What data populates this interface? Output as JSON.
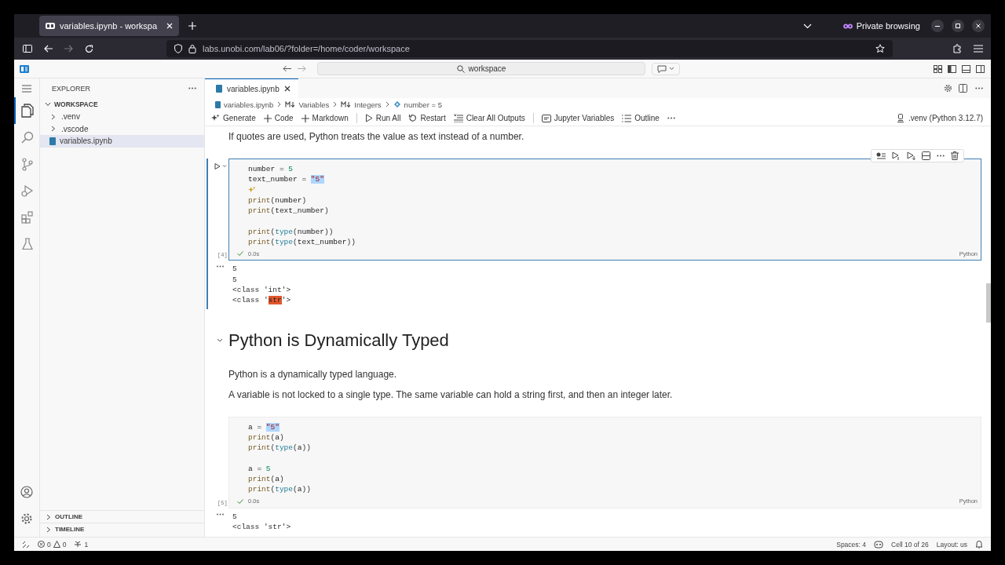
{
  "browser": {
    "tab_title": "variables.ipynb - workspa",
    "private_label": "Private browsing",
    "url": "labs.unobi.com/lab06/?folder=/home/coder/workspace"
  },
  "command_center": {
    "label": "workspace"
  },
  "activity_bar": [
    {
      "kind": "explorer",
      "selected": true
    },
    {
      "kind": "search",
      "selected": false
    },
    {
      "kind": "source-control",
      "selected": false
    },
    {
      "kind": "run",
      "selected": false
    },
    {
      "kind": "extensions",
      "selected": false
    },
    {
      "kind": "testing",
      "selected": false
    }
  ],
  "sidebar": {
    "title": "EXPLORER",
    "section": "WORKSPACE",
    "items": [
      {
        "label": ".venv",
        "kind": "folder",
        "selected": false
      },
      {
        "label": ".vscode",
        "kind": "folder",
        "selected": false
      },
      {
        "label": "variables.ipynb",
        "kind": "notebook",
        "selected": true
      }
    ],
    "panels": [
      {
        "label": "OUTLINE"
      },
      {
        "label": "TIMELINE"
      }
    ]
  },
  "editor": {
    "tabs": [
      {
        "label": "variables.ipynb",
        "selected": true
      }
    ],
    "breadcrumbs": [
      {
        "label": "variables.ipynb",
        "kind": "notebook"
      },
      {
        "label": "Variables",
        "kind": "markdown"
      },
      {
        "label": "Integers",
        "kind": "markdown"
      },
      {
        "label": "number = 5",
        "kind": "code"
      }
    ],
    "toolbar": [
      [
        {
          "label": "Generate",
          "kind": "generate"
        },
        {
          "label": "Code",
          "kind": "add"
        },
        {
          "label": "Markdown",
          "kind": "add"
        }
      ],
      [
        {
          "label": "Run All",
          "kind": "run"
        },
        {
          "label": "Restart",
          "kind": "restart"
        },
        {
          "label": "Clear All Outputs",
          "kind": "clear"
        }
      ],
      [
        {
          "label": "Jupyter Variables",
          "kind": "variables"
        },
        {
          "label": "Outline",
          "kind": "outline"
        }
      ]
    ],
    "kernel": ".venv (Python 3.12.7)"
  },
  "cells": [
    {
      "kind": "markdown",
      "paragraphs": [
        "If quotes are used, Python treats the value as text instead of a number."
      ]
    },
    {
      "kind": "code",
      "selected": true,
      "count": "[4]",
      "duration": "0.0s",
      "language": "Python",
      "lines": [
        {
          "kind": "code",
          "tokens": [
            {
              "text": "number",
              "kind": "id"
            },
            {
              "text": " = ",
              "kind": "op"
            },
            {
              "text": "5",
              "kind": "num"
            }
          ]
        },
        {
          "kind": "code",
          "tokens": [
            {
              "text": "text_number",
              "kind": "id"
            },
            {
              "text": " = ",
              "kind": "op"
            },
            {
              "text": "\"5\"",
              "kind": "str",
              "highlighted": true
            }
          ]
        },
        {
          "kind": "hint"
        },
        {
          "kind": "code",
          "tokens": [
            {
              "text": "print",
              "kind": "fn"
            },
            {
              "text": "(",
              "kind": "op"
            },
            {
              "text": "number",
              "kind": "id"
            },
            {
              "text": ")",
              "kind": "op"
            }
          ]
        },
        {
          "kind": "code",
          "tokens": [
            {
              "text": "print",
              "kind": "fn"
            },
            {
              "text": "(",
              "kind": "op"
            },
            {
              "text": "text_number",
              "kind": "id"
            },
            {
              "text": ")",
              "kind": "op"
            }
          ]
        },
        {
          "kind": "blank"
        },
        {
          "kind": "code",
          "tokens": [
            {
              "text": "print",
              "kind": "fn"
            },
            {
              "text": "(",
              "kind": "op"
            },
            {
              "text": "type",
              "kind": "type"
            },
            {
              "text": "(",
              "kind": "op"
            },
            {
              "text": "number",
              "kind": "id"
            },
            {
              "text": "))",
              "kind": "op"
            }
          ]
        },
        {
          "kind": "code",
          "tokens": [
            {
              "text": "print",
              "kind": "fn"
            },
            {
              "text": "(",
              "kind": "op"
            },
            {
              "text": "type",
              "kind": "type"
            },
            {
              "text": "(",
              "kind": "op"
            },
            {
              "text": "text_number",
              "kind": "id"
            },
            {
              "text": "))",
              "kind": "op"
            }
          ]
        }
      ],
      "output": [
        {
          "tokens": [
            {
              "text": "5"
            }
          ]
        },
        {
          "tokens": [
            {
              "text": "5"
            }
          ]
        },
        {
          "tokens": [
            {
              "text": "<class 'int'>"
            }
          ]
        },
        {
          "tokens": [
            {
              "text": "<class '"
            },
            {
              "text": "str",
              "highlighted": true
            },
            {
              "text": "'>"
            }
          ]
        }
      ]
    },
    {
      "kind": "heading",
      "title": "Python is Dynamically Typed",
      "paragraphs": [
        "Python is a dynamically typed language.",
        "A variable is not locked to a single type. The same variable can hold a string first, and then an integer later."
      ]
    },
    {
      "kind": "code",
      "selected": false,
      "count": "[5]",
      "duration": "0.0s",
      "language": "Python",
      "lines": [
        {
          "kind": "code",
          "tokens": [
            {
              "text": "a",
              "kind": "id"
            },
            {
              "text": " = ",
              "kind": "op"
            },
            {
              "text": "\"5\"",
              "kind": "str",
              "highlighted": true
            }
          ]
        },
        {
          "kind": "code",
          "tokens": [
            {
              "text": "print",
              "kind": "fn"
            },
            {
              "text": "(",
              "kind": "op"
            },
            {
              "text": "a",
              "kind": "id"
            },
            {
              "text": ")",
              "kind": "op"
            }
          ]
        },
        {
          "kind": "code",
          "tokens": [
            {
              "text": "print",
              "kind": "fn"
            },
            {
              "text": "(",
              "kind": "op"
            },
            {
              "text": "type",
              "kind": "type"
            },
            {
              "text": "(",
              "kind": "op"
            },
            {
              "text": "a",
              "kind": "id"
            },
            {
              "text": "))",
              "kind": "op"
            }
          ]
        },
        {
          "kind": "blank"
        },
        {
          "kind": "code",
          "tokens": [
            {
              "text": "a",
              "kind": "id"
            },
            {
              "text": " = ",
              "kind": "op"
            },
            {
              "text": "5",
              "kind": "num"
            }
          ]
        },
        {
          "kind": "code",
          "tokens": [
            {
              "text": "print",
              "kind": "fn"
            },
            {
              "text": "(",
              "kind": "op"
            },
            {
              "text": "a",
              "kind": "id"
            },
            {
              "text": ")",
              "kind": "op"
            }
          ]
        },
        {
          "kind": "code",
          "tokens": [
            {
              "text": "print",
              "kind": "fn"
            },
            {
              "text": "(",
              "kind": "op"
            },
            {
              "text": "type",
              "kind": "type"
            },
            {
              "text": "(",
              "kind": "op"
            },
            {
              "text": "a",
              "kind": "id"
            },
            {
              "text": "))",
              "kind": "op"
            }
          ]
        }
      ],
      "output": [
        {
          "tokens": [
            {
              "text": "5"
            }
          ]
        },
        {
          "tokens": [
            {
              "text": "<class 'str'>"
            }
          ]
        }
      ]
    }
  ],
  "status_bar": {
    "errors": "0",
    "warnings": "0",
    "ports": "1",
    "items": [
      {
        "label": "Spaces: 4",
        "kind": "text"
      },
      {
        "label": "Cell 10 of 26",
        "kind": "copilot"
      },
      {
        "label": "Layout: us",
        "kind": "text"
      }
    ]
  }
}
